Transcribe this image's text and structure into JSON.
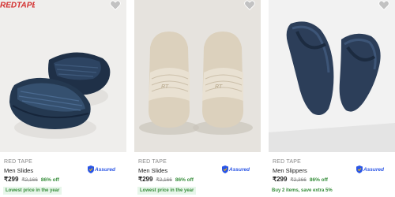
{
  "products": [
    {
      "brand": "RED TAPE",
      "title": "Men Slides",
      "price": "₹299",
      "mrp": "₹2,166",
      "discount": "86% off",
      "badge": "Lowest price in the year",
      "assured": "Assured",
      "logo_text": "REDTAPE"
    },
    {
      "brand": "RED TAPE",
      "title": "Men Slides",
      "price": "₹299",
      "mrp": "₹2,166",
      "discount": "86% off",
      "badge": "Lowest price in the year",
      "assured": "Assured"
    },
    {
      "brand": "RED TAPE",
      "title": "Men Slippers",
      "price": "₹299",
      "mrp": "₹2,366",
      "discount": "86% off",
      "offer": "Buy 2 items, save extra 5%",
      "assured": "Assured"
    }
  ],
  "colors": {
    "discount": "#388e3c",
    "assured": "#2a55e5",
    "logo": "#d32f2f"
  }
}
